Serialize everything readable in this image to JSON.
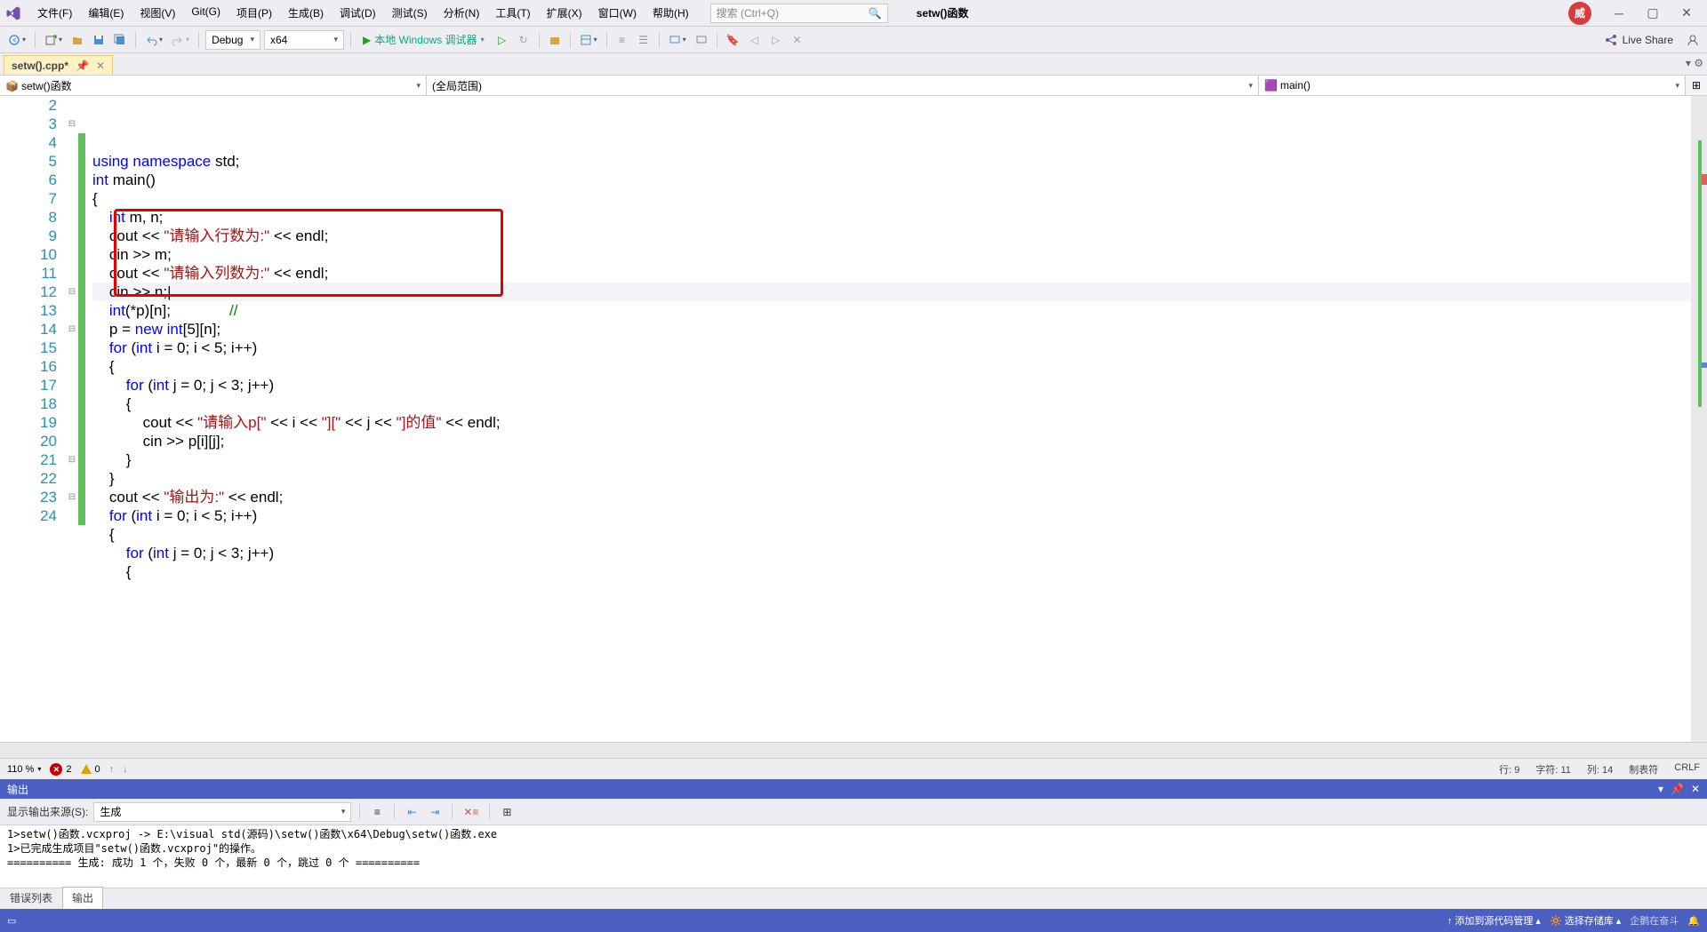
{
  "menu": {
    "items": [
      "文件(F)",
      "编辑(E)",
      "视图(V)",
      "Git(G)",
      "项目(P)",
      "生成(B)",
      "调试(D)",
      "测试(S)",
      "分析(N)",
      "工具(T)",
      "扩展(X)",
      "窗口(W)",
      "帮助(H)"
    ],
    "search_placeholder": "搜索 (Ctrl+Q)",
    "title": "setw()函数",
    "user_initial": "威"
  },
  "toolbar": {
    "config": "Debug",
    "platform": "x64",
    "debug_button": "本地 Windows 调试器",
    "live_share": "Live Share"
  },
  "tabs": {
    "active": "setw().cpp*"
  },
  "nav": {
    "scope1": "setw()函数",
    "scope2": "(全局范围)",
    "scope3": "main()"
  },
  "code": {
    "lines": [
      {
        "n": 2,
        "fold": "",
        "mark": "",
        "tokens": [
          [
            "kw",
            "using"
          ],
          [
            "",
            " "
          ],
          [
            "kw",
            "namespace"
          ],
          [
            "",
            " std;"
          ]
        ]
      },
      {
        "n": 3,
        "fold": "⊟",
        "mark": "",
        "tokens": [
          [
            "kw",
            "int"
          ],
          [
            "",
            " "
          ],
          [
            "",
            "main"
          ],
          [
            "",
            "()"
          ]
        ]
      },
      {
        "n": 4,
        "fold": "",
        "mark": "green",
        "tokens": [
          [
            "",
            "{"
          ]
        ]
      },
      {
        "n": 5,
        "fold": "",
        "mark": "green",
        "tokens": [
          [
            "",
            "    "
          ],
          [
            "kw",
            "int"
          ],
          [
            "",
            " m, n;"
          ]
        ]
      },
      {
        "n": 6,
        "fold": "",
        "mark": "green",
        "tokens": [
          [
            "",
            "    cout << "
          ],
          [
            "str",
            "\"请输入行数为:\""
          ],
          [
            "",
            " << endl;"
          ]
        ]
      },
      {
        "n": 7,
        "fold": "",
        "mark": "green",
        "tokens": [
          [
            "",
            "    cin >> m;"
          ]
        ]
      },
      {
        "n": 8,
        "fold": "",
        "mark": "green",
        "tokens": [
          [
            "",
            "    cout << "
          ],
          [
            "str",
            "\"请输入列数为:\""
          ],
          [
            "",
            " << endl;"
          ]
        ]
      },
      {
        "n": 9,
        "fold": "",
        "mark": "green",
        "active": true,
        "tokens": [
          [
            "",
            "    cin >> n;|"
          ]
        ]
      },
      {
        "n": 10,
        "fold": "",
        "mark": "green",
        "tokens": [
          [
            "",
            "    "
          ],
          [
            "kw",
            "int"
          ],
          [
            "",
            "(*p)["
          ],
          [
            "",
            "n"
          ],
          [
            "",
            "];              "
          ],
          [
            "cmt",
            "//"
          ]
        ]
      },
      {
        "n": 11,
        "fold": "",
        "mark": "green",
        "tokens": [
          [
            "",
            "    p = "
          ],
          [
            "kw",
            "new"
          ],
          [
            "",
            " "
          ],
          [
            "kw",
            "int"
          ],
          [
            "",
            "[5][n];"
          ]
        ]
      },
      {
        "n": 12,
        "fold": "⊟",
        "mark": "green",
        "tokens": [
          [
            "",
            "    "
          ],
          [
            "kw",
            "for"
          ],
          [
            "",
            " ("
          ],
          [
            "kw",
            "int"
          ],
          [
            "",
            " i = 0; i < 5; i++)"
          ]
        ]
      },
      {
        "n": 13,
        "fold": "",
        "mark": "green",
        "tokens": [
          [
            "",
            "    {"
          ]
        ]
      },
      {
        "n": 14,
        "fold": "⊟",
        "mark": "green",
        "tokens": [
          [
            "",
            "        "
          ],
          [
            "kw",
            "for"
          ],
          [
            "",
            " ("
          ],
          [
            "kw",
            "int"
          ],
          [
            "",
            " j = 0; j < 3; j++)"
          ]
        ]
      },
      {
        "n": 15,
        "fold": "",
        "mark": "green",
        "tokens": [
          [
            "",
            "        {"
          ]
        ]
      },
      {
        "n": 16,
        "fold": "",
        "mark": "green",
        "tokens": [
          [
            "",
            "            cout << "
          ],
          [
            "str",
            "\"请输入p[\""
          ],
          [
            "",
            " << i << "
          ],
          [
            "str",
            "\"][\""
          ],
          [
            "",
            " << j << "
          ],
          [
            "str",
            "\"]的值\""
          ],
          [
            "",
            " << endl;"
          ]
        ]
      },
      {
        "n": 17,
        "fold": "",
        "mark": "green",
        "tokens": [
          [
            "",
            "            cin >> p[i][j];"
          ]
        ]
      },
      {
        "n": 18,
        "fold": "",
        "mark": "green",
        "tokens": [
          [
            "",
            "        }"
          ]
        ]
      },
      {
        "n": 19,
        "fold": "",
        "mark": "green",
        "tokens": [
          [
            "",
            "    }"
          ]
        ]
      },
      {
        "n": 20,
        "fold": "",
        "mark": "green",
        "tokens": [
          [
            "",
            "    cout << "
          ],
          [
            "str",
            "\"输出为:\""
          ],
          [
            "",
            " << endl;"
          ]
        ]
      },
      {
        "n": 21,
        "fold": "⊟",
        "mark": "green",
        "tokens": [
          [
            "",
            "    "
          ],
          [
            "kw",
            "for"
          ],
          [
            "",
            " ("
          ],
          [
            "kw",
            "int"
          ],
          [
            "",
            " i = 0; i < 5; i++)"
          ]
        ]
      },
      {
        "n": 22,
        "fold": "",
        "mark": "green",
        "tokens": [
          [
            "",
            "    {"
          ]
        ]
      },
      {
        "n": 23,
        "fold": "⊟",
        "mark": "green",
        "tokens": [
          [
            "",
            "        "
          ],
          [
            "kw",
            "for"
          ],
          [
            "",
            " ("
          ],
          [
            "kw",
            "int"
          ],
          [
            "",
            " j = 0; j < 3; j++)"
          ]
        ]
      },
      {
        "n": 24,
        "fold": "",
        "mark": "green",
        "tokens": [
          [
            "",
            "        {"
          ]
        ]
      }
    ]
  },
  "status": {
    "zoom": "110 %",
    "errors": "2",
    "warnings": "0",
    "line_lbl": "行: 9",
    "char_lbl": "字符: 11",
    "col_lbl": "列: 14",
    "tab_lbl": "制表符",
    "crlf": "CRLF"
  },
  "output": {
    "title": "输出",
    "source_label": "显示输出来源(S):",
    "source_value": "生成",
    "text": "1>setw()函数.vcxproj -> E:\\visual std(源码)\\setw()函数\\x64\\Debug\\setw()函数.exe\n1>已完成生成项目\"setw()函数.vcxproj\"的操作。\n========== 生成: 成功 1 个，失败 0 个，最新 0 个，跳过 0 个 ==========",
    "tabs": [
      "错误列表",
      "输出"
    ],
    "active_tab": 1
  },
  "bottom": {
    "source_control": "添加到源代码管理",
    "repo": "选择存储库",
    "watermark": "企鹅在奋斗"
  }
}
